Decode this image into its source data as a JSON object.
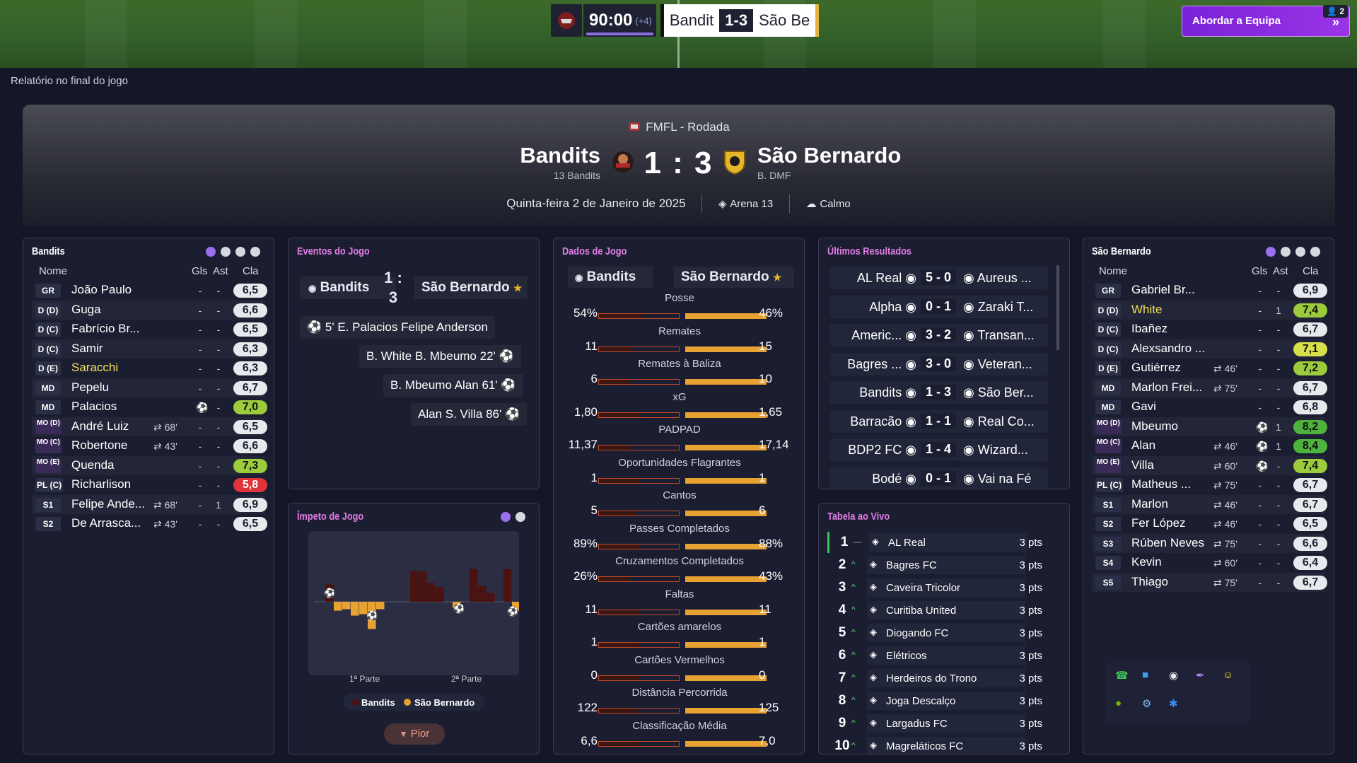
{
  "topbar": {
    "clock": "90:00",
    "added_time": "(+4)",
    "home_abbr": "Bandit",
    "score": "1-3",
    "away_abbr": "São Be",
    "tactic_button": "Abordar a Equipa",
    "tactic_count": "2"
  },
  "report_label": "Relatório no final do jogo",
  "header": {
    "competition": "FMFL - Rodada",
    "home_team": "Bandits",
    "home_sub": "13 Bandits",
    "score": "1 : 3",
    "away_team": "São Bernardo",
    "away_sub": "B. DMF",
    "date": "Quinta-feira 2 de Janeiro de 2025",
    "stadium": "Arena 13",
    "weather": "Calmo"
  },
  "home_panel": {
    "title": "Bandits",
    "col_name": "Nome",
    "col_gls": "Gls",
    "col_ast": "Ast",
    "col_rating": "Cla",
    "players": [
      {
        "pos": "GR",
        "name": "João Paulo",
        "sub": "",
        "gls": "-",
        "ast": "-",
        "rating": "6,5",
        "rc": ""
      },
      {
        "pos": "D (D)",
        "name": "Guga",
        "sub": "",
        "gls": "-",
        "ast": "-",
        "rating": "6,6",
        "rc": ""
      },
      {
        "pos": "D (C)",
        "name": "Fabrício Br...",
        "sub": "",
        "gls": "-",
        "ast": "-",
        "rating": "6,5",
        "rc": ""
      },
      {
        "pos": "D (C)",
        "name": "Samir",
        "sub": "",
        "gls": "-",
        "ast": "-",
        "rating": "6,3",
        "rc": ""
      },
      {
        "pos": "D (E)",
        "name": "Saracchi",
        "sub": "",
        "gls": "-",
        "ast": "-",
        "rating": "6,3",
        "rc": "",
        "yellow": true
      },
      {
        "pos": "MD",
        "name": "Pepelu",
        "sub": "",
        "gls": "-",
        "ast": "-",
        "rating": "6,7",
        "rc": ""
      },
      {
        "pos": "MD",
        "name": "Palacios",
        "sub": "",
        "gls": "⚽",
        "ast": "-",
        "rating": "7,0",
        "rc": "g"
      },
      {
        "pos": "MO (D)",
        "name": "André Luiz",
        "sub": "68'",
        "gls": "-",
        "ast": "-",
        "rating": "6,5",
        "rc": ""
      },
      {
        "pos": "MO (C)",
        "name": "Robertone",
        "sub": "43'",
        "gls": "-",
        "ast": "-",
        "rating": "6,6",
        "rc": ""
      },
      {
        "pos": "MO (E)",
        "name": "Quenda",
        "sub": "",
        "gls": "-",
        "ast": "-",
        "rating": "7,3",
        "rc": "g"
      },
      {
        "pos": "PL (C)",
        "name": "Richarlison",
        "sub": "",
        "gls": "-",
        "ast": "-",
        "rating": "5,8",
        "rc": "red"
      },
      {
        "pos": "S1",
        "name": "Felipe Ande...",
        "sub": "68'",
        "gls": "-",
        "ast": "1",
        "rating": "6,9",
        "rc": ""
      },
      {
        "pos": "S2",
        "name": "De Arrasca...",
        "sub": "43'",
        "gls": "-",
        "ast": "-",
        "rating": "6,5",
        "rc": ""
      }
    ]
  },
  "events": {
    "title": "Eventos do Jogo",
    "home": "Bandits",
    "score": "1 : 3",
    "away": "São Bernardo",
    "list": [
      {
        "side": "home",
        "text": "5'  E. Palacios  Felipe Anderson"
      },
      {
        "side": "away",
        "text": "B. White  B. Mbeumo  22'"
      },
      {
        "side": "away",
        "text": "B. Mbeumo  Alan  61'"
      },
      {
        "side": "away",
        "text": "Alan  S. Villa  86'"
      }
    ]
  },
  "momentum": {
    "title": "Ímpeto de Jogo",
    "first_half": "1ª Parte",
    "second_half": "2ª Parte",
    "legend_home": "Bandits",
    "legend_away": "São Bernardo",
    "worse_button": "Pior",
    "home_color": "#4a1210",
    "away_color": "#e8a232",
    "bars": [
      0,
      0.35,
      -0.18,
      -0.15,
      -0.28,
      -0.25,
      -0.55,
      -0.15,
      0,
      0,
      0,
      0.62,
      0.62,
      0.38,
      0.3,
      0,
      -0.12,
      0,
      0.66,
      0.32,
      0.18,
      0,
      0.66,
      -0.18
    ]
  },
  "stats": {
    "title": "Dados de Jogo",
    "home": "Bandits",
    "away": "São Bernardo",
    "items": [
      {
        "label": "Posse",
        "home": "54%",
        "away": "46%",
        "hf": 0.54
      },
      {
        "label": "Remates",
        "home": "11",
        "away": "15",
        "hf": 0.42
      },
      {
        "label": "Remates à Baliza",
        "home": "6",
        "away": "10",
        "hf": 0.38
      },
      {
        "label": "xG",
        "home": "1,80",
        "away": "1,65",
        "hf": 0.52
      },
      {
        "label": "PADPAD",
        "home": "11,37",
        "away": "17,14",
        "hf": 0.4
      },
      {
        "label": "Oportunidades Flagrantes",
        "home": "1",
        "away": "1",
        "hf": 0.5
      },
      {
        "label": "Cantos",
        "home": "5",
        "away": "6",
        "hf": 0.45
      },
      {
        "label": "Passes Completados",
        "home": "89%",
        "away": "88%",
        "hf": 0.5
      },
      {
        "label": "Cruzamentos Completados",
        "home": "26%",
        "away": "43%",
        "hf": 0.38
      },
      {
        "label": "Faltas",
        "home": "11",
        "away": "11",
        "hf": 0.5
      },
      {
        "label": "Cartões amarelos",
        "home": "1",
        "away": "1",
        "hf": 0.5
      },
      {
        "label": "Cartões Vermelhos",
        "home": "0",
        "away": "0",
        "hf": 0.5
      },
      {
        "label": "Distância Percorrida",
        "home": "122",
        "away": "125",
        "hf": 0.49
      },
      {
        "label": "Classificação Média",
        "home": "6,6",
        "away": "7,0",
        "hf": 0.48
      }
    ]
  },
  "results": {
    "title": "Últimos Resultados",
    "list": [
      {
        "home": "AL Real",
        "score": "5 - 0",
        "away": "Aureus ..."
      },
      {
        "home": "Alpha",
        "score": "0 - 1",
        "away": "Zaraki T..."
      },
      {
        "home": "Americ...",
        "score": "3 - 2",
        "away": "Transan..."
      },
      {
        "home": "Bagres ...",
        "score": "3 - 0",
        "away": "Veteran..."
      },
      {
        "home": "Bandits",
        "score": "1 - 3",
        "away": "São Ber..."
      },
      {
        "home": "Barracão",
        "score": "1 - 1",
        "away": "Real Co..."
      },
      {
        "home": "BDP2 FC",
        "score": "1 - 4",
        "away": "Wizard..."
      },
      {
        "home": "Bodé",
        "score": "0 - 1",
        "away": "Vai na Fé"
      }
    ]
  },
  "league_table": {
    "title": "Tabela ao Vivo",
    "rows": [
      {
        "pos": "1",
        "trend": "—",
        "team": "AL Real",
        "pts": "3 pts"
      },
      {
        "pos": "2",
        "trend": "^",
        "team": "Bagres FC",
        "pts": "3 pts"
      },
      {
        "pos": "3",
        "trend": "^",
        "team": "Caveira Tricolor",
        "pts": "3 pts"
      },
      {
        "pos": "4",
        "trend": "^",
        "team": "Curitiba United",
        "pts": "3 pts"
      },
      {
        "pos": "5",
        "trend": "^",
        "team": "Diogando FC",
        "pts": "3 pts"
      },
      {
        "pos": "6",
        "trend": "^",
        "team": "Elétricos",
        "pts": "3 pts"
      },
      {
        "pos": "7",
        "trend": "^",
        "team": "Herdeiros do Trono",
        "pts": "3 pts"
      },
      {
        "pos": "8",
        "trend": "^",
        "team": "Joga Descalço",
        "pts": "3 pts"
      },
      {
        "pos": "9",
        "trend": "^",
        "team": "Largadus FC",
        "pts": "3 pts"
      },
      {
        "pos": "10",
        "trend": "^",
        "team": "Magreláticos FC",
        "pts": "3 pts"
      }
    ]
  },
  "away_panel": {
    "title": "São Bernardo",
    "col_name": "Nome",
    "col_gls": "Gls",
    "col_ast": "Ast",
    "col_rating": "Cla",
    "players": [
      {
        "pos": "GR",
        "name": "Gabriel Br...",
        "sub": "",
        "gls": "-",
        "ast": "-",
        "rating": "6,9",
        "rc": ""
      },
      {
        "pos": "D (D)",
        "name": "White",
        "sub": "",
        "gls": "-",
        "ast": "1",
        "rating": "7,4",
        "rc": "g",
        "yellow": true
      },
      {
        "pos": "D (C)",
        "name": "Ibañez",
        "sub": "",
        "gls": "-",
        "ast": "-",
        "rating": "6,7",
        "rc": ""
      },
      {
        "pos": "D (C)",
        "name": "Alexsandro ...",
        "sub": "",
        "gls": "-",
        "ast": "-",
        "rating": "7,1",
        "rc": "yel"
      },
      {
        "pos": "D (E)",
        "name": "Gutiérrez",
        "sub": "46'",
        "gls": "-",
        "ast": "-",
        "rating": "7,2",
        "rc": "g"
      },
      {
        "pos": "MD",
        "name": "Marlon Frei...",
        "sub": "75'",
        "gls": "-",
        "ast": "-",
        "rating": "6,7",
        "rc": ""
      },
      {
        "pos": "MD",
        "name": "Gavi",
        "sub": "",
        "gls": "-",
        "ast": "-",
        "rating": "6,8",
        "rc": ""
      },
      {
        "pos": "MO (D)",
        "name": "Mbeumo",
        "sub": "",
        "gls": "⚽",
        "ast": "1",
        "rating": "8,2",
        "rc": "gg"
      },
      {
        "pos": "MO (C)",
        "name": "Alan",
        "sub": "46'",
        "gls": "⚽",
        "ast": "1",
        "rating": "8,4",
        "rc": "gg"
      },
      {
        "pos": "MO (E)",
        "name": "Villa",
        "sub": "60'",
        "gls": "⚽",
        "ast": "-",
        "rating": "7,4",
        "rc": "g"
      },
      {
        "pos": "PL (C)",
        "name": "Matheus ...",
        "sub": "75'",
        "gls": "-",
        "ast": "-",
        "rating": "6,7",
        "rc": ""
      },
      {
        "pos": "S1",
        "name": "Marlon",
        "sub": "46'",
        "gls": "-",
        "ast": "-",
        "rating": "6,7",
        "rc": ""
      },
      {
        "pos": "S2",
        "name": "Fer López",
        "sub": "46'",
        "gls": "-",
        "ast": "-",
        "rating": "6,5",
        "rc": ""
      },
      {
        "pos": "S3",
        "name": "Rúben Neves",
        "sub": "75'",
        "gls": "-",
        "ast": "-",
        "rating": "6,6",
        "rc": ""
      },
      {
        "pos": "S4",
        "name": "Kevin",
        "sub": "60'",
        "gls": "-",
        "ast": "-",
        "rating": "6,4",
        "rc": ""
      },
      {
        "pos": "S5",
        "name": "Thiago",
        "sub": "75'",
        "gls": "-",
        "ast": "-",
        "rating": "6,7",
        "rc": ""
      }
    ]
  },
  "social_icons": [
    "whatsapp-icon",
    "messenger-icon",
    "discord-icon",
    "feather-icon",
    "snapchat-icon",
    "nvidia-icon",
    "steam-icon",
    "bluetooth-icon"
  ]
}
